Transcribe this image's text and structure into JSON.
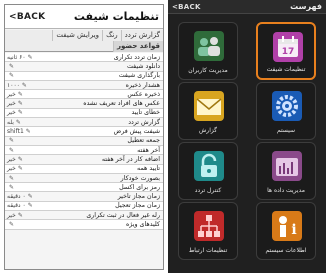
{
  "left": {
    "title": "تنظیمات شیفت",
    "back_label": "<BACK",
    "tabs": [
      {
        "label": "گزارش تردد",
        "active": false
      },
      {
        "label": "رنگ",
        "active": false
      },
      {
        "label": "ویرایش شیفت",
        "active": false
      },
      {
        "label": "قواعد حضور",
        "active": true
      }
    ],
    "rows": [
      {
        "label": "زمان تردد تکراری",
        "value": "۶۰ ثانیه"
      },
      {
        "label": "دانلود شیفت",
        "value": ""
      },
      {
        "label": "بارگذاری شیفت",
        "value": ""
      },
      {
        "label": "هشدار ذخیره",
        "value": "۱۰۰۰"
      },
      {
        "label": "ذخیره عکس",
        "value": "خیر"
      },
      {
        "label": "عکس های افراد تعریف نشده",
        "value": "خیر"
      },
      {
        "label": "خطای تایید",
        "value": "خیر"
      },
      {
        "label": "گزارش تردد",
        "value": "بله"
      },
      {
        "label": "شیفت پیش فرض",
        "value": "shift1"
      },
      {
        "label": "جمعه تعطیل",
        "value": ""
      },
      {
        "label": "آخر هفته",
        "value": ""
      },
      {
        "label": "اضافه کار در آخر هفته",
        "value": "خیر"
      },
      {
        "label": "تایید همه",
        "value": "خیر"
      },
      {
        "label": "بصورت خودکار",
        "value": ""
      },
      {
        "label": "رمز برای اکسل",
        "value": ""
      },
      {
        "label": "زمان مجاز تاخیر",
        "value": "۰ دقیقه"
      },
      {
        "label": "زمان مجاز تعجیل",
        "value": "۰ دقیقه"
      },
      {
        "label": "رله غیر فعال در ثبت تکراری",
        "value": "خیر"
      },
      {
        "label": "کلیدهای ویژه",
        "value": ""
      }
    ]
  },
  "right": {
    "title": "فهرست",
    "back_label": "<BACK",
    "tiles": [
      {
        "label": "تنظیمات شیفت",
        "icon": "calendar-icon",
        "color": "#b040a8",
        "selected": true,
        "number": "17"
      },
      {
        "label": "مدیریت کاربران",
        "icon": "users-icon",
        "color": "#2f6b3a",
        "selected": false,
        "number": ""
      },
      {
        "label": "سیستم",
        "icon": "gear-icon",
        "color": "#1a5bb5",
        "selected": false,
        "number": ""
      },
      {
        "label": "گزارش",
        "icon": "mail-icon",
        "color": "#d8a520",
        "selected": false,
        "number": ""
      },
      {
        "label": "مدیریت داده ها",
        "icon": "database-icon",
        "color": "#8a4a8a",
        "selected": false,
        "number": ""
      },
      {
        "label": "کنترل تردد",
        "icon": "lock-icon",
        "color": "#1f8a8a",
        "selected": false,
        "number": ""
      },
      {
        "label": "اطلاعات سیستم",
        "icon": "info-icon",
        "color": "#d87a18",
        "selected": false,
        "number": ""
      },
      {
        "label": "تنظیمات ارتباط",
        "icon": "network-icon",
        "color": "#c02a2a",
        "selected": false,
        "number": ""
      }
    ]
  }
}
